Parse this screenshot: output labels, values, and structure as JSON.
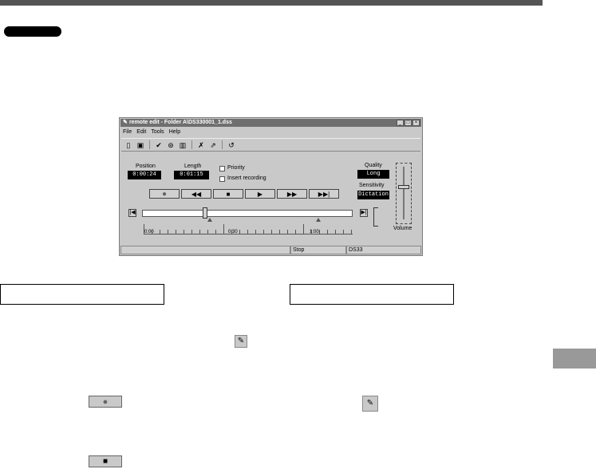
{
  "window": {
    "title": "remote edit - Folder A\\DS330001_1.dss",
    "menu": [
      "File",
      "Edit",
      "Tools",
      "Help"
    ],
    "title_buttons": [
      "_",
      "□",
      "×"
    ],
    "position_label": "Position",
    "position_value": "0:00:24",
    "length_label": "Length",
    "length_value": "0:01:15",
    "priority_label": "Priority",
    "insert_label": "Insert recording",
    "quality_label": "Quality",
    "quality_value": "Long",
    "sensitivity_label": "Sensitivity",
    "sensitivity_value": "Dictation",
    "volume_label": "Volume",
    "playback_progress": 0.3,
    "volume_level": 0.65,
    "ruler_labels": [
      "0:00",
      "0:30",
      "1:00"
    ],
    "status": [
      "",
      "Stop",
      "DS33"
    ]
  },
  "colors": {
    "topbar": "#555555",
    "window_bg": "#c9c9c9",
    "titlebar": "#6f6f6f",
    "lcd": "#000000",
    "side_tab": "#999999"
  },
  "icons": {
    "toolbar": [
      "new-document-icon",
      "save-icon",
      "checkmark-icon",
      "send-icon",
      "book-icon",
      "erase-icon",
      "edit-icon",
      "undo-icon"
    ],
    "controls": [
      "record-icon",
      "rewind-icon",
      "stop-icon",
      "play-icon",
      "fast-forward-icon",
      "skip-end-icon"
    ]
  }
}
